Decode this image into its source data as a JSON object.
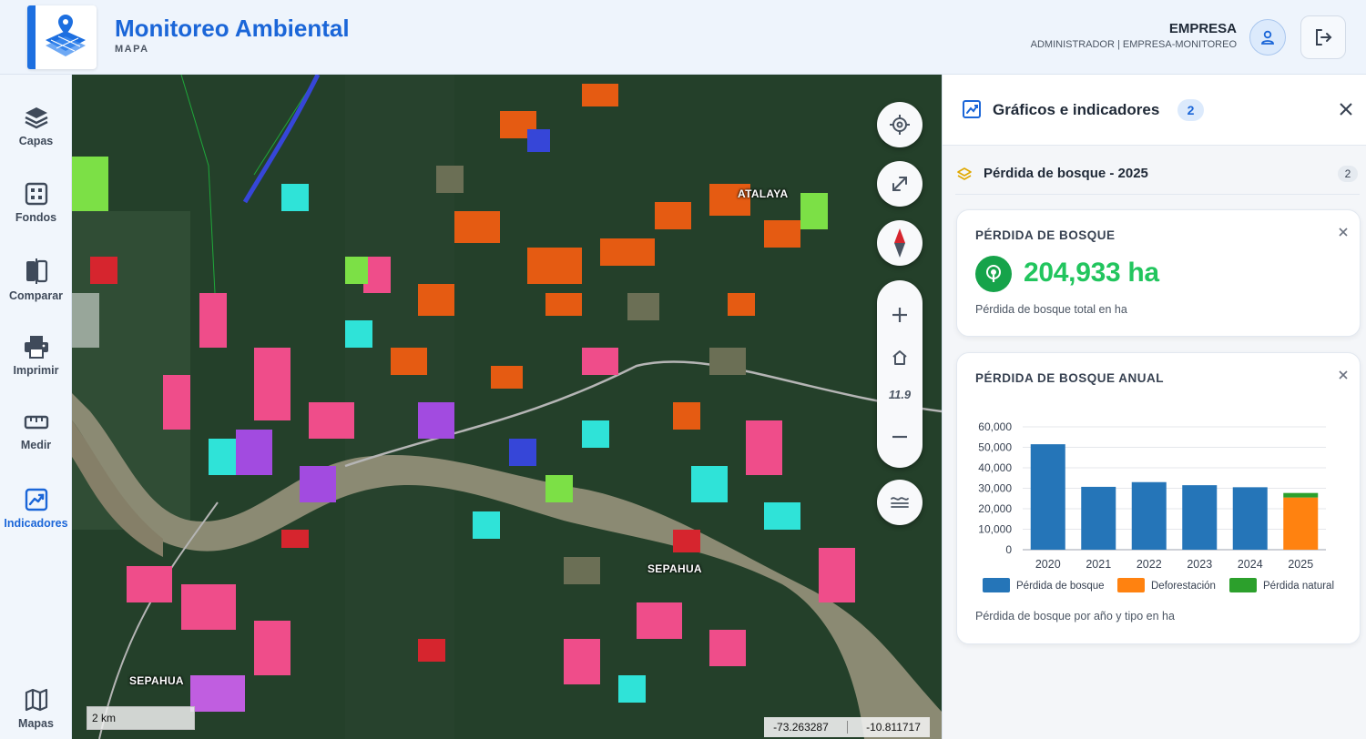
{
  "header": {
    "title": "Monitoreo Ambiental",
    "subtitle": "MAPA",
    "user_name": "EMPRESA",
    "user_role": "ADMINISTRADOR | EMPRESA-MONITOREO"
  },
  "sidebar": {
    "items": [
      {
        "label": "Capas",
        "icon": "layers-icon"
      },
      {
        "label": "Fondos",
        "icon": "grid-icon"
      },
      {
        "label": "Comparar",
        "icon": "compare-icon"
      },
      {
        "label": "Imprimir",
        "icon": "printer-icon"
      },
      {
        "label": "Medir",
        "icon": "ruler-icon"
      },
      {
        "label": "Indicadores",
        "icon": "chart-icon",
        "active": true
      },
      {
        "label": "Mapas",
        "icon": "map-icon"
      }
    ]
  },
  "map": {
    "zoom": "11.9",
    "scale": "2 km",
    "lon": "-73.263287",
    "lat": "-10.811717",
    "places": [
      "ATALAYA",
      "SEPAHUA",
      "SEPAHUA"
    ]
  },
  "panel": {
    "title": "Gráficos e indicadores",
    "badge": "2",
    "layer_name": "Pérdida de bosque - 2025",
    "layer_count": "2",
    "kpi_card": {
      "title": "PÉRDIDA DE BOSQUE",
      "value": "204,933 ha",
      "description": "Pérdida de bosque total en ha"
    },
    "chart_card": {
      "title": "PÉRDIDA DE BOSQUE ANUAL",
      "description": "Pérdida de bosque por año y tipo en ha"
    }
  },
  "colors": {
    "accent": "#1b66d8",
    "kpi_green": "#22c55e",
    "series_blue": "#2575b8",
    "series_orange": "#ff8210",
    "series_green": "#2ca02c"
  },
  "chart_data": {
    "type": "bar",
    "stacked": true,
    "categories": [
      "2020",
      "2021",
      "2022",
      "2023",
      "2024",
      "2025"
    ],
    "series": [
      {
        "name": "Pérdida de bosque",
        "values": [
          51500,
          30700,
          33000,
          31500,
          30500,
          0
        ],
        "color": "#2575b8"
      },
      {
        "name": "Deforestación",
        "values": [
          0,
          0,
          0,
          0,
          0,
          25500
        ],
        "color": "#ff8210"
      },
      {
        "name": "Pérdida natural",
        "values": [
          0,
          0,
          0,
          0,
          0,
          2200
        ],
        "color": "#2ca02c"
      }
    ],
    "yticks": [
      "0",
      "10,000",
      "20,000",
      "30,000",
      "40,000",
      "50,000",
      "60,000"
    ],
    "ylim": [
      0,
      60000
    ],
    "grid": true,
    "legend": "bottom"
  }
}
